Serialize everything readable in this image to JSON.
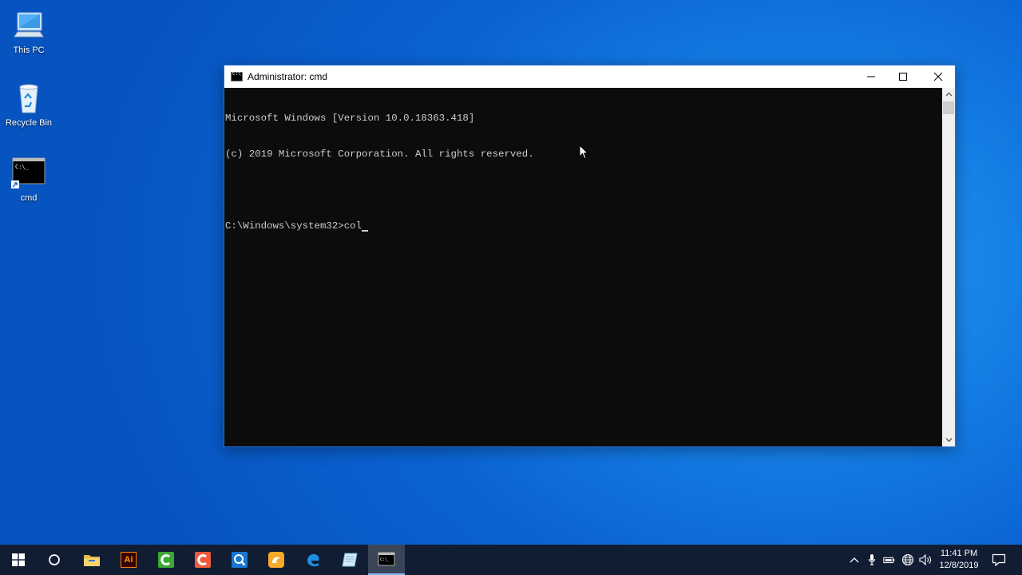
{
  "desktop": {
    "icons": [
      {
        "label": "This PC",
        "icon": "this-pc-icon"
      },
      {
        "label": "Recycle Bin",
        "icon": "recycle-bin-icon"
      },
      {
        "label": "cmd",
        "icon": "cmd-shortcut-icon"
      }
    ]
  },
  "window": {
    "title": "Administrator: cmd",
    "console_lines": [
      "Microsoft Windows [Version 10.0.18363.418]",
      "(c) 2019 Microsoft Corporation. All rights reserved.",
      "",
      "C:\\Windows\\system32>col"
    ]
  },
  "taskbar": {
    "apps": [
      {
        "name": "start",
        "icon": "windows-logo-icon"
      },
      {
        "name": "search",
        "icon": "cortana-circle-icon"
      },
      {
        "name": "file-explorer",
        "icon": "folder-icon"
      },
      {
        "name": "illustrator",
        "icon": "illustrator-icon"
      },
      {
        "name": "camtasia-green",
        "icon": "green-c-icon"
      },
      {
        "name": "camtasia-red",
        "icon": "red-c-icon"
      },
      {
        "name": "search-app",
        "icon": "magnifier-app-icon"
      },
      {
        "name": "ucbrowser",
        "icon": "uc-browser-icon"
      },
      {
        "name": "edge",
        "icon": "edge-icon"
      },
      {
        "name": "notepad",
        "icon": "notepad-icon"
      },
      {
        "name": "cmd",
        "icon": "cmd-icon"
      }
    ],
    "illustrator_label": "Ai",
    "time": "11:41 PM",
    "date": "12/8/2019"
  },
  "colors": {
    "console_bg": "#0c0c0c",
    "console_text": "#cccccc",
    "taskbar_bg": "#101d33"
  }
}
